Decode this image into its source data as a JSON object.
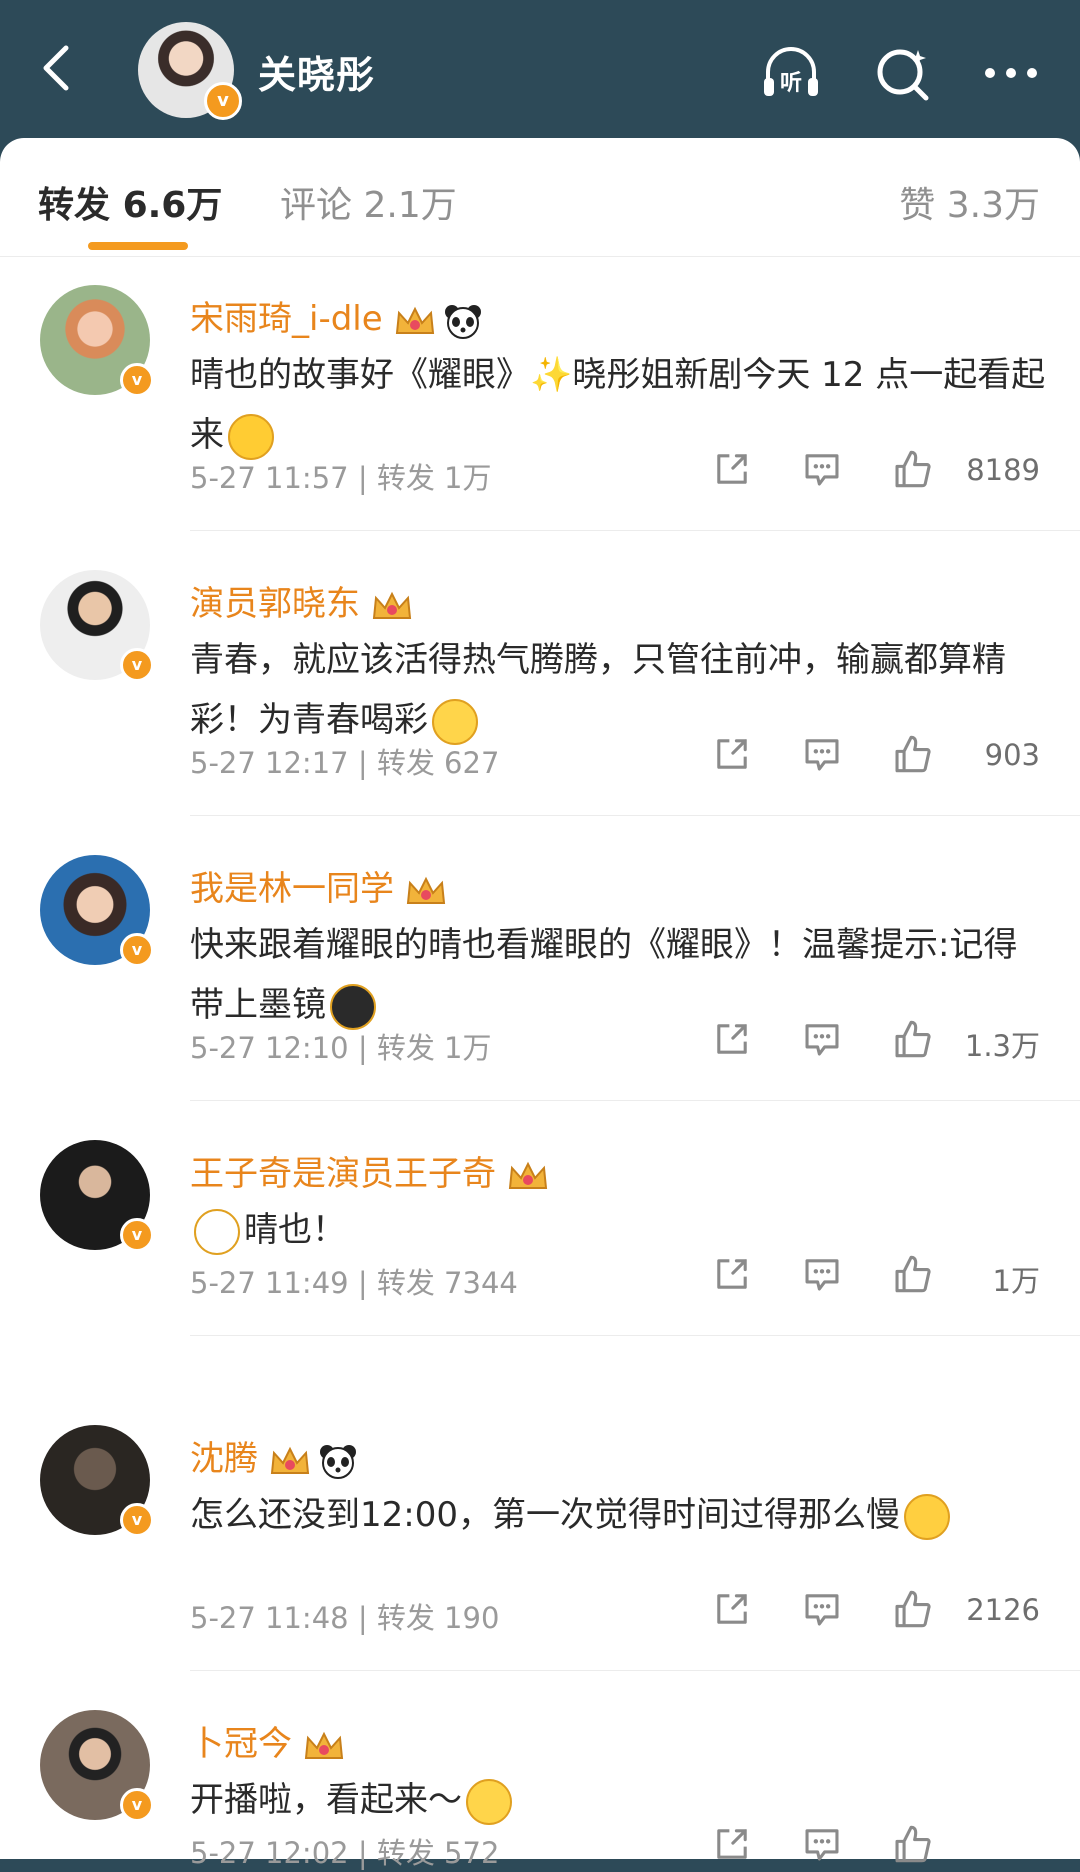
{
  "header": {
    "title": "关晓彤",
    "verified_badge": "v",
    "icons": [
      "back-icon",
      "listen-icon",
      "search-icon",
      "more-icon"
    ],
    "listen_label": "听"
  },
  "tabs": [
    {
      "label": "转发",
      "count": "6.6万"
    },
    {
      "label": "评论",
      "count": "2.1万"
    },
    {
      "label": "赞",
      "count": "3.3万"
    }
  ],
  "comments": [
    {
      "name": "宋雨琦_i-dle",
      "text": "晴也的故事好《耀眼》✨晓彤姐新剧今天 12 点一起看起来",
      "emoji": "😭",
      "time": "5-27 11:57",
      "forward": "转发 1万",
      "likes": "8189",
      "panda": true
    },
    {
      "name": "演员郭晓东",
      "text": "青春，就应该活得热气腾腾，只管往前冲，输赢都算精彩！为青春喝彩",
      "emoji": "😊",
      "time": "5-27 12:17",
      "forward": "转发 627",
      "likes": "903",
      "panda": false
    },
    {
      "name": "我是林一同学",
      "text": "快来跟着耀眼的晴也看耀眼的《耀眼》！温馨提示:记得带上墨镜",
      "emoji": "😎",
      "time": "5-27 12:10",
      "forward": "转发 1万",
      "likes": "1.3万",
      "panda": false
    },
    {
      "name": "王子奇是演员王子奇",
      "text": "晴也！",
      "emoji": "👀",
      "time": "5-27 11:49",
      "forward": "转发 7344",
      "likes": "1万",
      "panda": false
    },
    {
      "name": "沈腾",
      "text": "怎么还没到12:00，第一次觉得时间过得那么慢",
      "emoji": "🤷",
      "time": "5-27 11:48",
      "forward": "转发 190",
      "likes": "2126",
      "panda": true
    },
    {
      "name": "卜冠今",
      "text": "开播啦，看起来～",
      "emoji": "😊",
      "time": "5-27 12:02",
      "forward": "转发 572",
      "likes": "",
      "panda": false
    }
  ],
  "colors": {
    "header_bg": "#2d4a58",
    "accent": "#f49a1f",
    "name": "#e8851c"
  }
}
